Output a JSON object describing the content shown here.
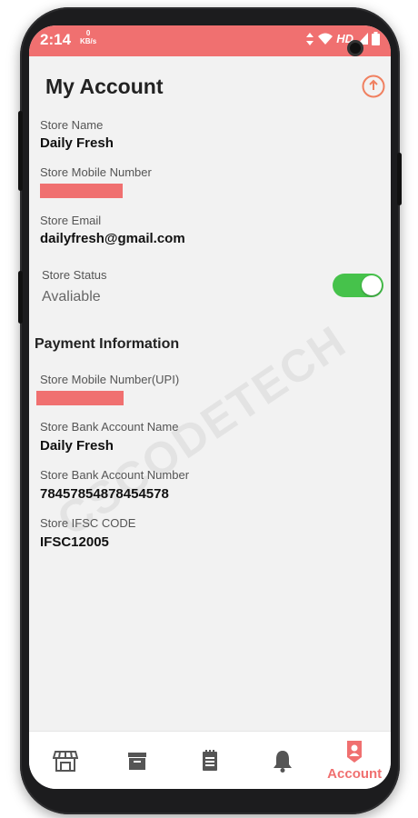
{
  "status_bar": {
    "time": "2:14",
    "net_speed": "0",
    "net_unit": "KB/s",
    "hd": "HD"
  },
  "header": {
    "title": "My Account",
    "action_icon": "share-upload-icon"
  },
  "store": {
    "name_label": "Store Name",
    "name_value": "Daily Fresh",
    "mobile_label": "Store Mobile Number",
    "email_label": "Store Email",
    "email_value": "dailyfresh@gmail.com",
    "status_label": "Store Status",
    "status_value": "Avaliable",
    "status_enabled": true
  },
  "payment": {
    "section_title": "Payment Information",
    "upi_label": "Store Mobile Number(UPI)",
    "bank_name_label": "Store Bank Account Name",
    "bank_name_value": "Daily Fresh",
    "bank_number_label": "Store Bank Account Number",
    "bank_number_value": "78457854878454578",
    "ifsc_label": "Store IFSC CODE",
    "ifsc_value": "IFSC12005"
  },
  "watermark": "CSCODETECH",
  "bottom_nav": {
    "items": [
      {
        "icon": "store-icon"
      },
      {
        "icon": "archive-box-icon"
      },
      {
        "icon": "notepad-icon"
      },
      {
        "icon": "bell-icon"
      },
      {
        "icon": "account-icon",
        "label": "Account",
        "active": true
      }
    ]
  },
  "colors": {
    "accent": "#f07070",
    "toggle_on": "#46c24b",
    "background": "#f2f2f2"
  }
}
